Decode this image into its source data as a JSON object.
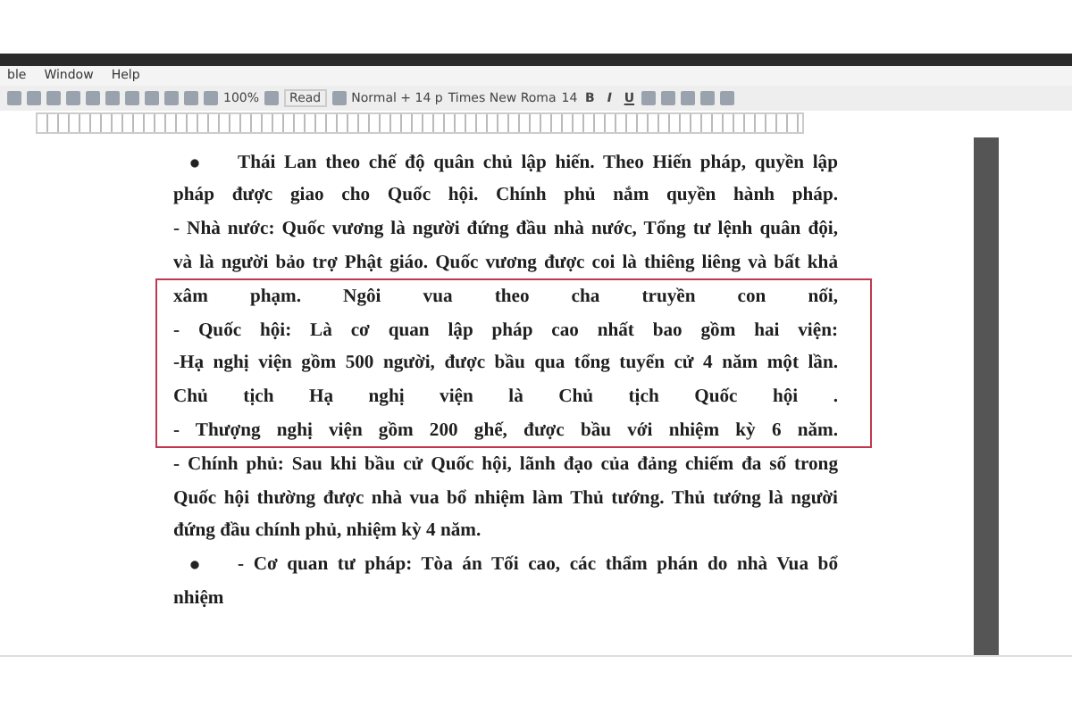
{
  "menu": [
    {
      "label": "ble"
    },
    {
      "label": "Window"
    },
    {
      "label": "Help"
    }
  ],
  "toolbar": {
    "zoom": "100%",
    "read": "Read",
    "style": "Normal + 14 p",
    "font": "Times New Roma",
    "size": "14",
    "format_buttons": [
      {
        "kind": "bold",
        "label": "B"
      },
      {
        "kind": "italic",
        "label": "I"
      },
      {
        "kind": "underline",
        "label": "U"
      }
    ]
  },
  "document": {
    "lines_before": [
      {
        "text": "Thái Lan theo chế độ quân chủ lập hiến. Theo Hiến pháp, quyền lập",
        "bullet": true,
        "justify": true
      },
      {
        "text": "pháp được giao cho Quốc hội. Chính phủ nắm quyền hành pháp.",
        "bullet": false,
        "justify": true
      },
      {
        "text": "- Nhà nước: Quốc vương là người đứng đầu nhà nước, Tổng tư lệnh quân đội,",
        "bullet": false,
        "justify": true
      },
      {
        "text": "và là người bảo trợ Phật giáo. Quốc vương được coi là thiêng liêng và bất khả",
        "bullet": false,
        "justify": true
      }
    ],
    "highlight_box": {
      "lines": [
        {
          "text": "xâm phạm. Ngôi vua theo cha truyền con nối,",
          "bullet": false,
          "justify": true
        },
        {
          "text": "- Quốc hội: Là cơ quan lập pháp cao nhất bao gồm hai viện:",
          "bullet": false,
          "justify": true
        },
        {
          "text": "-Hạ nghị viện gồm 500 người, được bầu qua tổng tuyển cử 4 năm một lần.",
          "bullet": false,
          "justify": true
        },
        {
          "text": "Chủ tịch Hạ nghị viện là Chủ tịch Quốc hội .",
          "bullet": false,
          "justify": true
        },
        {
          "text": "- Thượng nghị viện gồm 200 ghế, được bầu với nhiệm kỳ 6 năm.",
          "bullet": false,
          "justify": true
        }
      ]
    },
    "lines_after": [
      {
        "text": "- Chính phủ: Sau khi bầu cử Quốc hội, lãnh đạo của đảng chiếm đa số trong",
        "bullet": false,
        "justify": true
      },
      {
        "text": "Quốc hội thường được nhà vua bổ nhiệm làm Thủ tướng. Thủ tướng là người",
        "bullet": false,
        "justify": true
      },
      {
        "text": "đứng đầu chính phủ, nhiệm kỳ 4 năm.",
        "bullet": false,
        "justify": false
      },
      {
        "text": "- Cơ quan tư pháp: Tòa án Tối cao, các thẩm phán do nhà Vua bổ",
        "bullet": true,
        "justify": true
      },
      {
        "text": "nhiệm",
        "bullet": false,
        "justify": false
      }
    ]
  }
}
